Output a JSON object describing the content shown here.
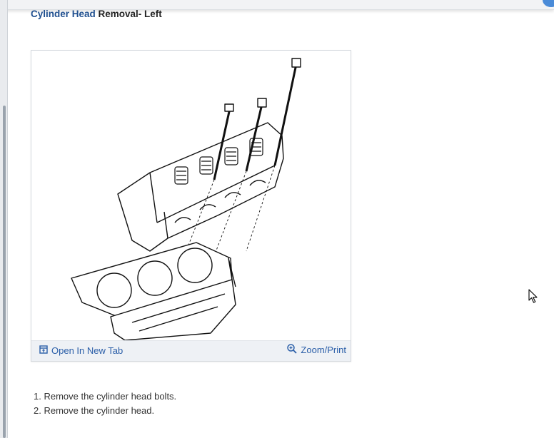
{
  "title": {
    "link_text": "Cylinder Head",
    "rest_text": " Removal- Left"
  },
  "figure": {
    "toolbar": {
      "open_label": "Open In New Tab",
      "open_icon": "open-in-new-tab-icon",
      "zoom_label": "Zoom/Print",
      "zoom_icon": "zoom-in-icon"
    }
  },
  "steps": [
    "1. Remove the cylinder head bolts.",
    "2. Remove the cylinder head."
  ],
  "colors": {
    "link": "#1f4f8f",
    "toolbar_text": "#2a5ea8",
    "toolbar_bg": "#eef1f5",
    "accent": "#4a8bd8"
  }
}
